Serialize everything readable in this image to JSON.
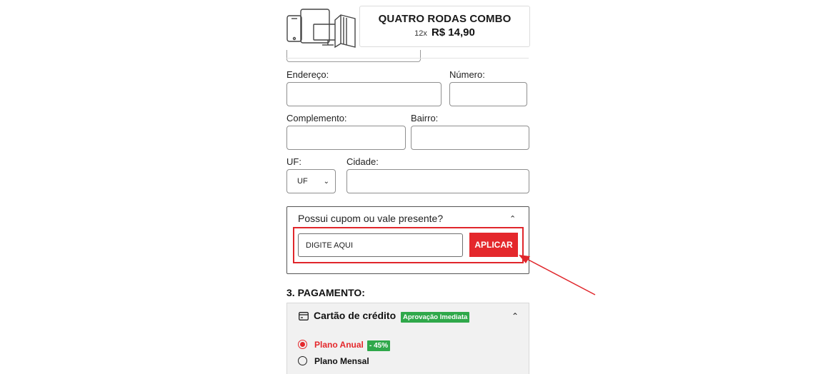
{
  "product": {
    "icon": "devices-icon",
    "title": "QUATRO RODAS COMBO",
    "installments": "12x",
    "price": "R$ 14,90"
  },
  "form": {
    "endereco_label": "Endereço:",
    "numero_label": "Número:",
    "complemento_label": "Complemento:",
    "bairro_label": "Bairro:",
    "uf_label": "UF:",
    "uf_value": "UF",
    "cidade_label": "Cidade:"
  },
  "coupon": {
    "question": "Possui cupom ou vale presente?",
    "input_value": "DIGITE AQUI",
    "apply_label": "APLICAR"
  },
  "payment": {
    "section_title": "3. PAGAMENTO:",
    "method_icon": "credit-card-icon",
    "method_label": "Cartão de crédito",
    "method_badge": "Aprovação Imediata",
    "plans": [
      {
        "label": "Plano Anual",
        "badge": "- 45%",
        "selected": true
      },
      {
        "label": "Plano Mensal",
        "selected": false
      }
    ]
  },
  "colors": {
    "accent_red": "#e4282c",
    "badge_green": "#2fa84a",
    "annotation_red": "#e0262b"
  }
}
